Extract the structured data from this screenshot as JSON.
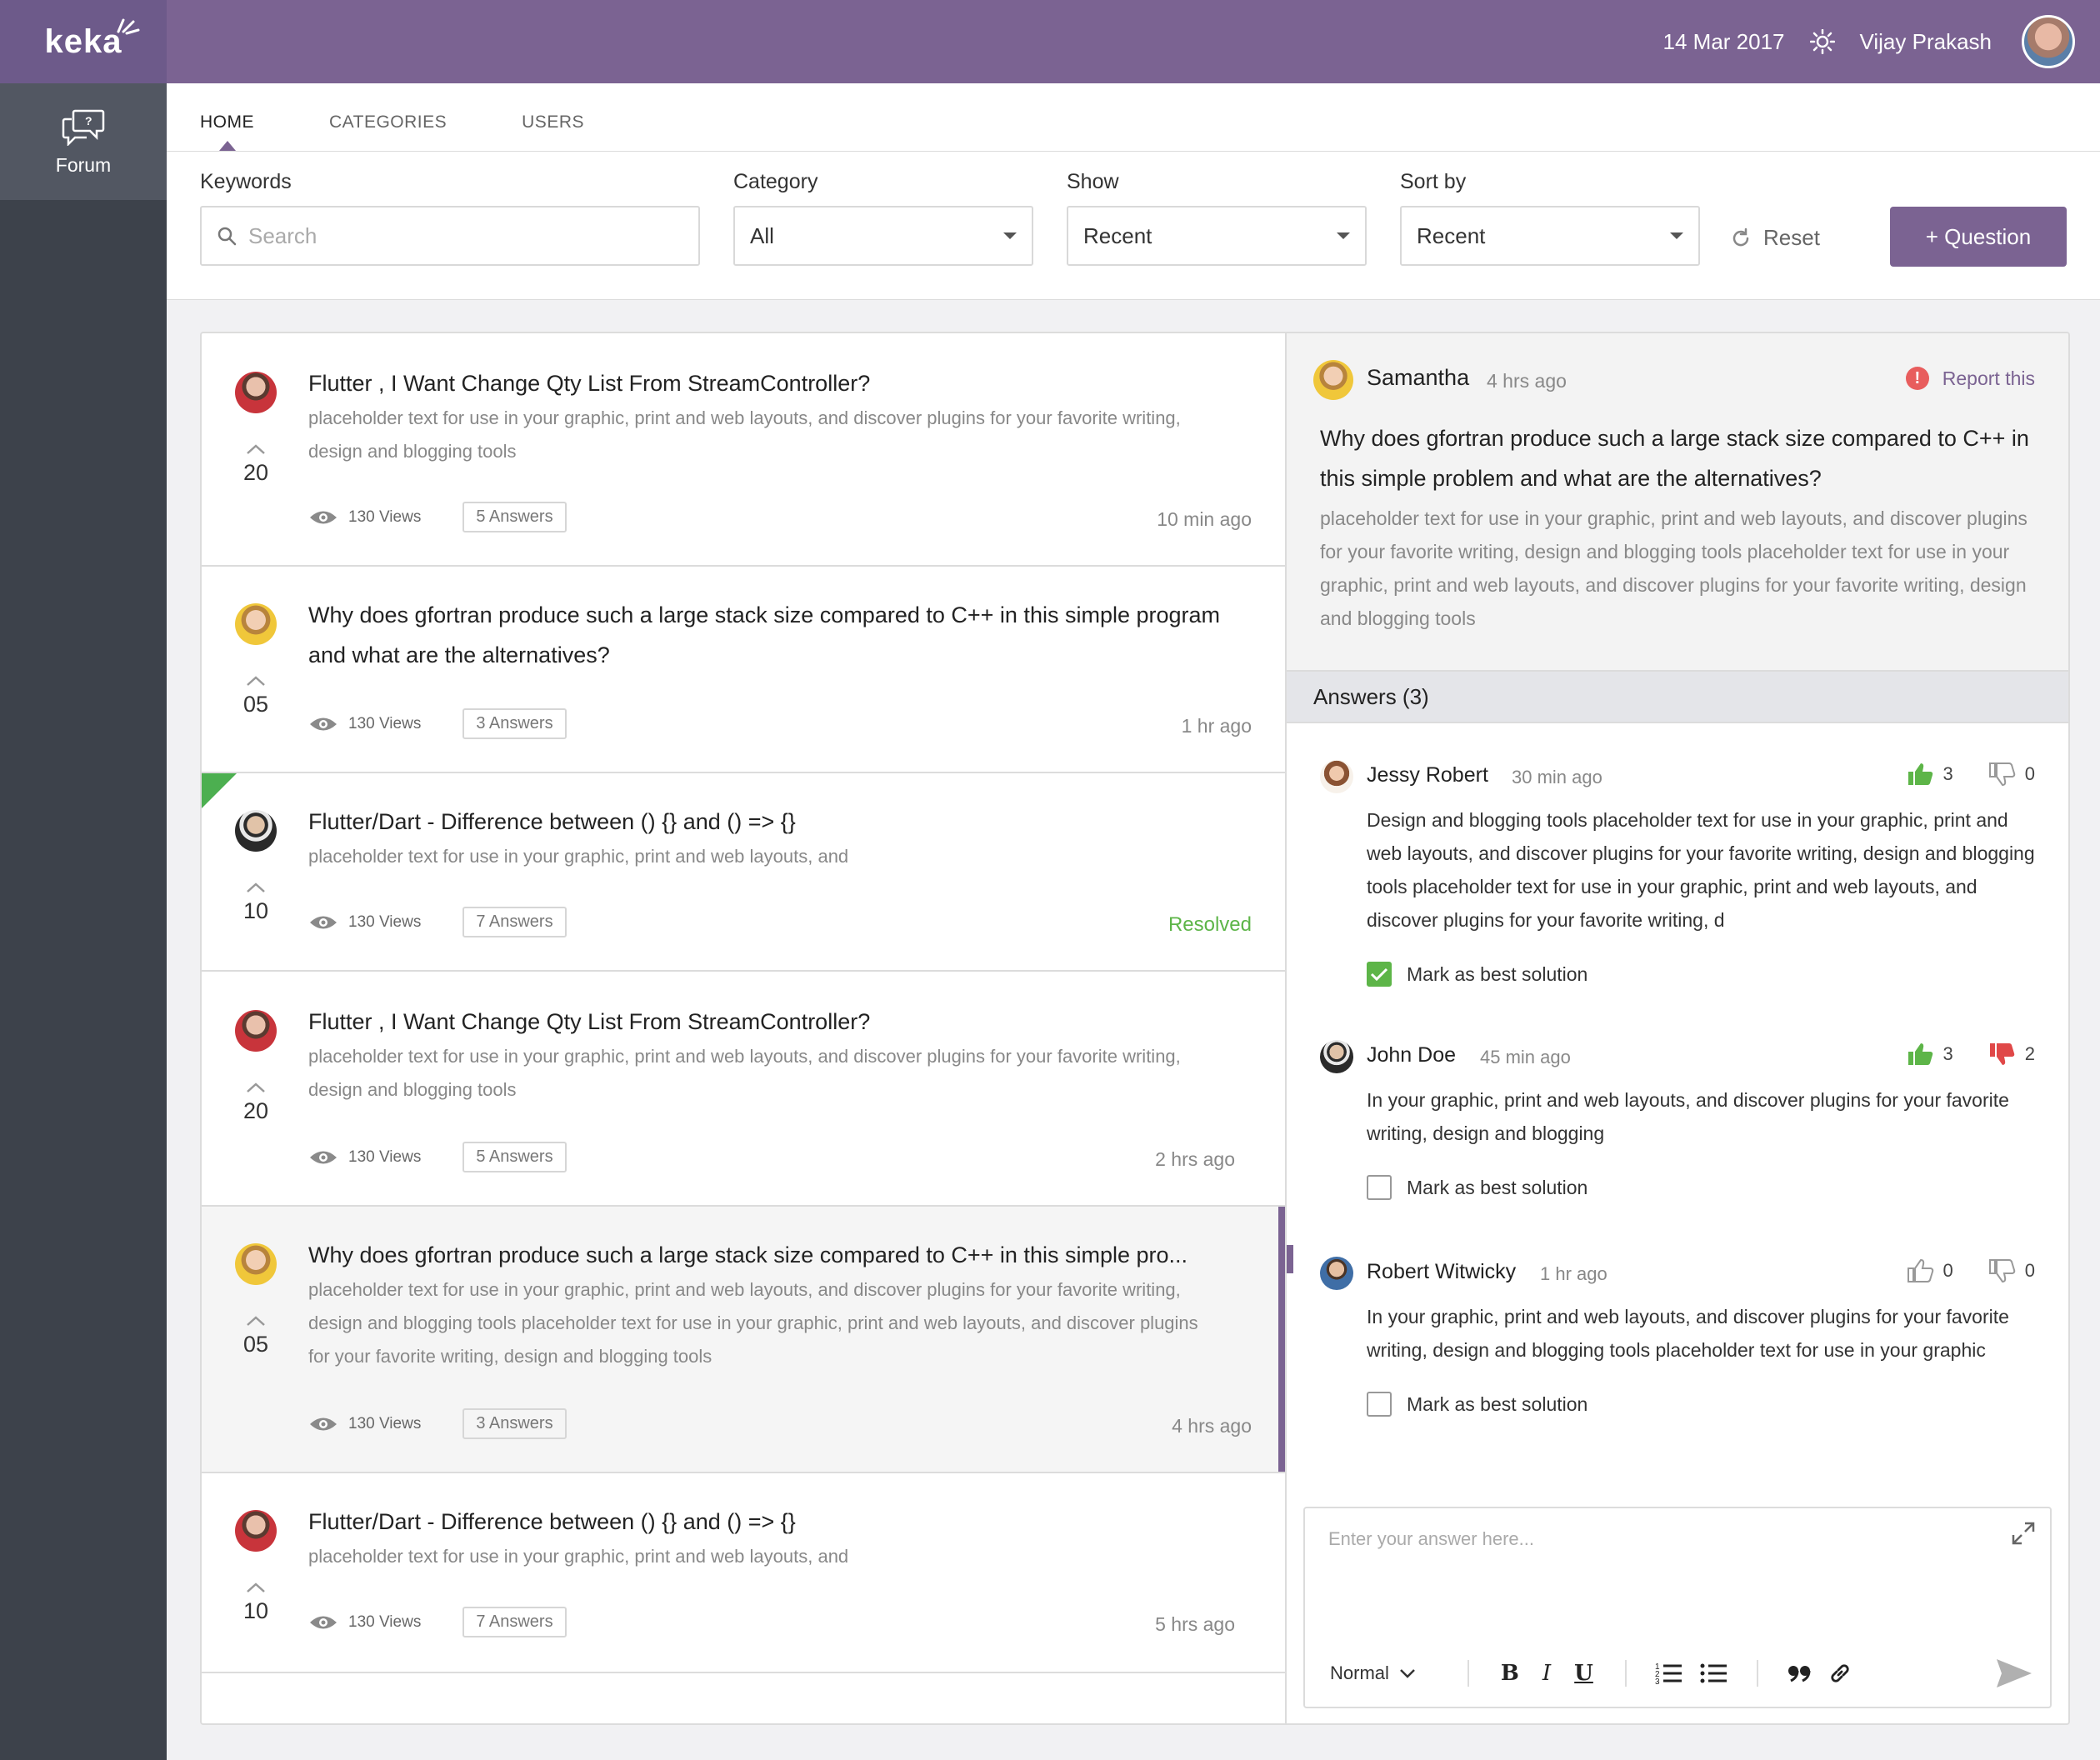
{
  "app": {
    "logo": "keka"
  },
  "sidebar": {
    "items": [
      {
        "label": "Forum"
      }
    ]
  },
  "topbar": {
    "date": "14 Mar 2017",
    "user_name": "Vijay Prakash"
  },
  "tabs": [
    {
      "label": "HOME"
    },
    {
      "label": "CATEGORIES"
    },
    {
      "label": "USERS"
    }
  ],
  "filters": {
    "keywords_label": "Keywords",
    "search_placeholder": "Search",
    "category_label": "Category",
    "category_value": "All",
    "show_label": "Show",
    "show_value": "Recent",
    "sort_label": "Sort by",
    "sort_value": "Recent",
    "reset_label": "Reset",
    "question_button": "+ Question"
  },
  "questions": [
    {
      "title": "Flutter , I Want Change Qty List From StreamController?",
      "desc": "placeholder text for use in your graphic, print and web layouts, and discover plugins for your favorite writing, design and blogging tools",
      "votes": "20",
      "views": "130 Views",
      "answers": "5 Answers",
      "time": "10 min ago"
    },
    {
      "title": "Why does gfortran produce such a large stack size compared to C++ in this simple program and what are the alternatives?",
      "desc": "",
      "votes": "05",
      "views": "130 Views",
      "answers": "3 Answers",
      "time": "1 hr ago"
    },
    {
      "title": "Flutter/Dart - Difference between () {} and () => {}",
      "desc": "placeholder text for use in your graphic, print and web layouts, and",
      "votes": "10",
      "views": "130 Views",
      "answers": "7 Answers",
      "time": "Resolved"
    },
    {
      "title": "Flutter , I Want Change Qty List From StreamController?",
      "desc": "placeholder text for use in your graphic, print and web layouts, and discover plugins for your favorite writing, design and blogging tools",
      "votes": "20",
      "views": "130 Views",
      "answers": "5 Answers",
      "time": "2 hrs ago"
    },
    {
      "title": "Why does gfortran produce such a large stack size compared to C++ in this simple pro...",
      "desc": "placeholder text for use in your graphic, print and web layouts, and discover plugins for your favorite writing, design and blogging tools placeholder text for use in your graphic, print and web layouts, and discover plugins for your favorite writing, design and blogging tools",
      "votes": "05",
      "views": "130 Views",
      "answers": "3 Answers",
      "time": "4 hrs ago"
    },
    {
      "title": "Flutter/Dart - Difference between () {} and () => {}",
      "desc": "placeholder text for use in your graphic, print and web layouts, and",
      "votes": "10",
      "views": "130 Views",
      "answers": "7 Answers",
      "time": "5 hrs ago"
    }
  ],
  "detail": {
    "author": "Samantha",
    "time": "4 hrs ago",
    "report_label": "Report this",
    "title": "Why does gfortran produce such a large stack size compared to C++ in this simple problem and what are the alternatives?",
    "body": "placeholder text for use in your graphic, print and web layouts, and discover plugins for your favorite writing, design and blogging tools placeholder text for use in your graphic, print and web layouts, and discover plugins for your favorite writing, design and blogging tools",
    "answers_heading": "Answers (3)",
    "answers": [
      {
        "name": "Jessy Robert",
        "time": "30 min ago",
        "likes": "3",
        "dislikes": "0",
        "text": "Design and blogging tools placeholder text for use in your graphic, print and web layouts, and discover plugins for your favorite writing, design and blogging tools placeholder text for use in your graphic, print and web layouts, and discover plugins for your favorite writing, d",
        "best_label": "Mark as best solution"
      },
      {
        "name": "John Doe",
        "time": "45 min ago",
        "likes": "3",
        "dislikes": "2",
        "text": "In your graphic, print and web layouts, and discover plugins for your favorite writing, design and blogging",
        "best_label": "Mark as best solution"
      },
      {
        "name": "Robert Witwicky",
        "time": "1 hr ago",
        "likes": "0",
        "dislikes": "0",
        "text": "In your graphic, print and web layouts, and discover plugins for your favorite writing, design and blogging tools placeholder text for use in your graphic",
        "best_label": "Mark as best solution"
      }
    ],
    "editor_placeholder": "Enter your answer here...",
    "editor_format": "Normal"
  }
}
